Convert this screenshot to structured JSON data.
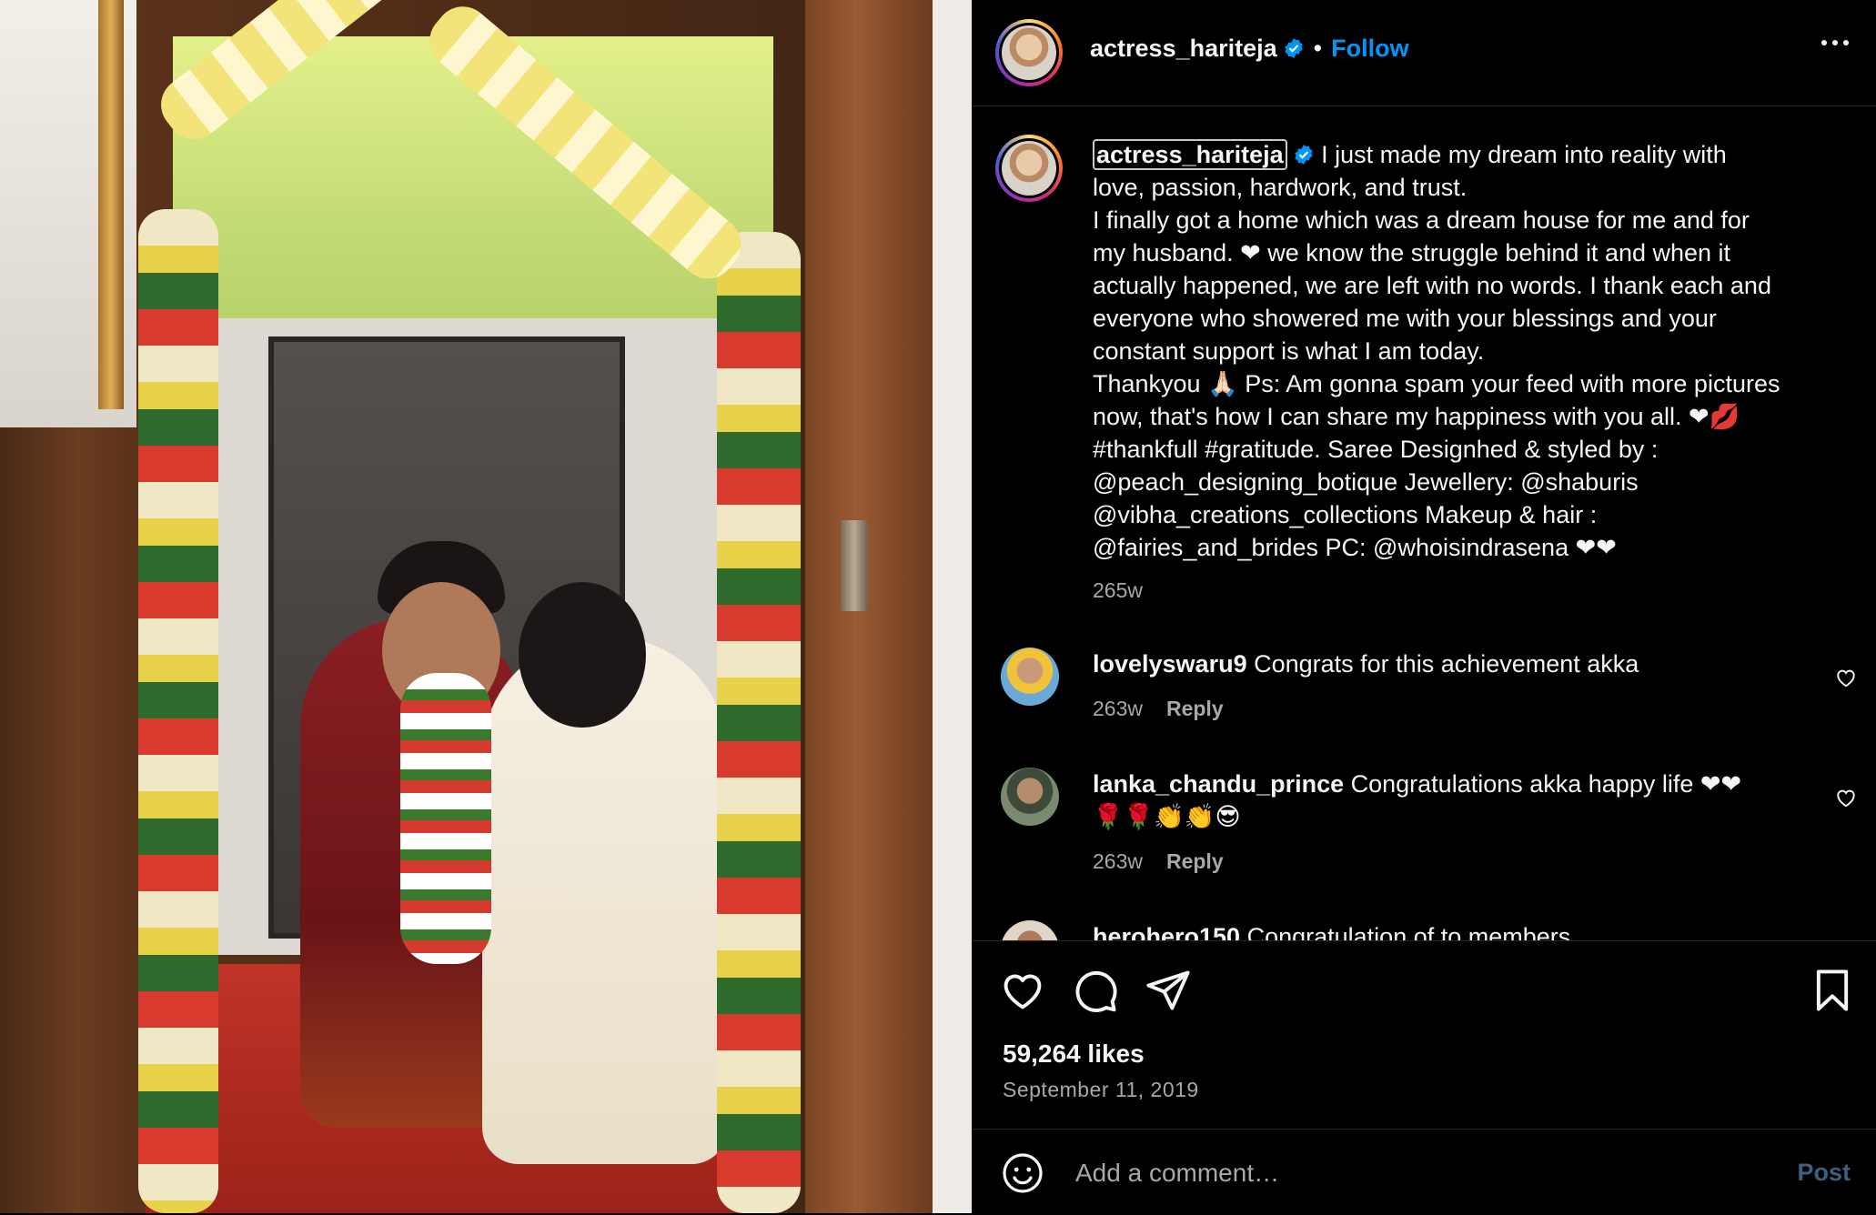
{
  "post": {
    "username": "actress_hariteja",
    "follow_label": "Follow",
    "separator": "•"
  },
  "caption": {
    "username": "actress_hariteja",
    "text": "I just made my dream into reality with\nlove, passion, hardwork, and trust.\nI finally got a home which was a dream house for me and for\nmy husband. ❤ we know the struggle behind it and when it\nactually happened, we are left with no words. I thank each and\neveryone who showered me with your blessings and your\nconstant support is what I am today.\nThankyou 🙏🏻 Ps: Am gonna spam your feed with more pictures\nnow, that's how I can share my happiness with you all. ❤💋\n#thankfull #gratitude. Saree Designhed & styled by :\n@peach_designing_botique Jewellery: @shaburis\n@vibha_creations_collections Makeup & hair :\n@fairies_and_brides PC: @whoisindrasena ❤❤",
    "time": "265w"
  },
  "comments": [
    {
      "username": "lovelyswaru9",
      "text": "Congrats for this achievement akka",
      "time": "263w",
      "reply": "Reply"
    },
    {
      "username": "lanka_chandu_prince",
      "text": "Congratulations akka happy life ❤❤\n🌹🌹👏👏😎",
      "time": "263w",
      "reply": "Reply"
    },
    {
      "username": "herohero150",
      "text": "Congratulation of to members"
    }
  ],
  "actions": {
    "likes": "59,264 likes",
    "date": "September 11, 2019"
  },
  "add_comment": {
    "placeholder": "Add a comment…",
    "post_label": "Post"
  },
  "colors": {
    "accent": "#0095f6",
    "background": "#000000",
    "muted": "#a8a8a8"
  },
  "icons": [
    "verified-badge-icon",
    "more-options-icon",
    "heart-icon",
    "comment-icon",
    "share-icon",
    "bookmark-icon",
    "emoji-icon"
  ]
}
